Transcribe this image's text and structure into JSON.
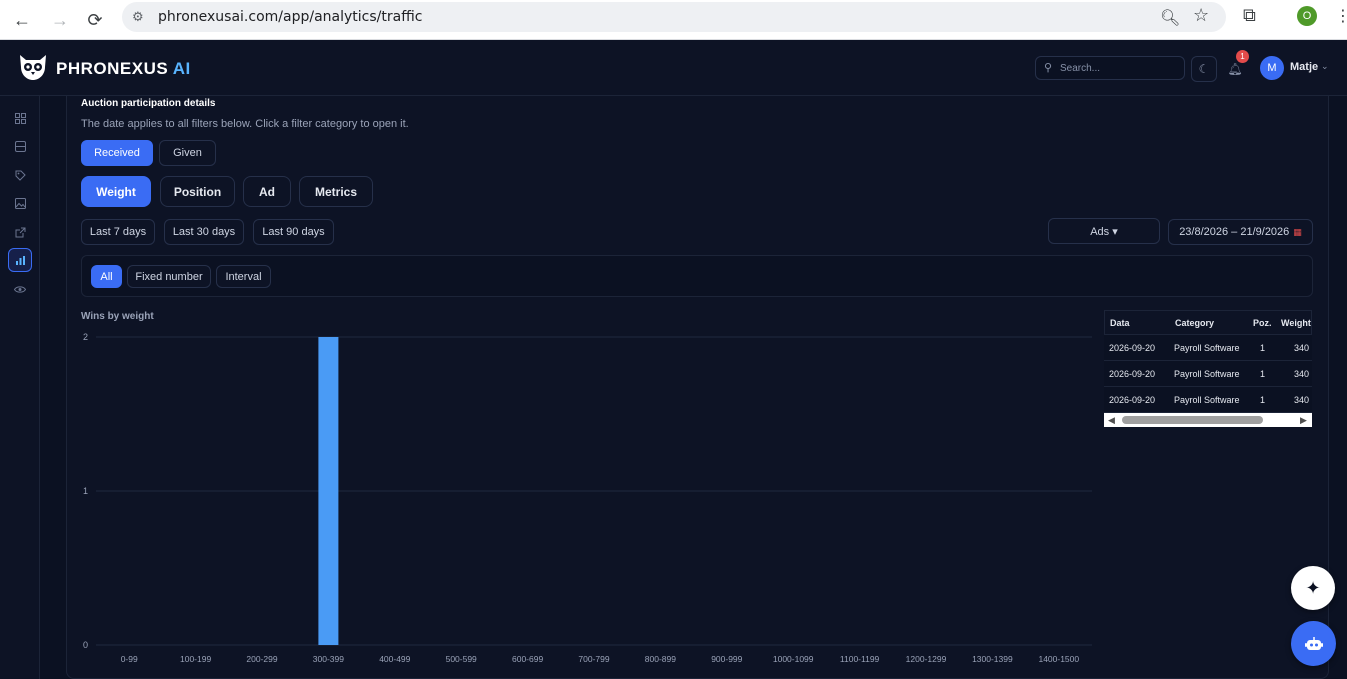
{
  "browser": {
    "url": "phronexusai.com/app/analytics/traffic",
    "profile_initial": "O",
    "icons": [
      "back-icon",
      "forward-icon",
      "reload-icon",
      "site-info-icon",
      "zoom-icon",
      "star-icon",
      "extensions-icon",
      "menu-icon"
    ]
  },
  "header": {
    "brand": "PHRONEXUS",
    "brand_suffix": "AI",
    "search_placeholder": "Search...",
    "notification_count": "1",
    "user_initial": "M",
    "user_name": "Matje"
  },
  "sidebar": {
    "items": [
      {
        "icon": "dashboard-icon"
      },
      {
        "icon": "database-icon"
      },
      {
        "icon": "tag-icon"
      },
      {
        "icon": "image-icon"
      },
      {
        "icon": "external-link-icon"
      },
      {
        "icon": "bar-chart-icon",
        "active": true
      },
      {
        "icon": "eye-icon"
      }
    ]
  },
  "section": {
    "title": "Auction participation details",
    "subtitle": "The date applies to all filters below. Click a filter category to open it."
  },
  "direction": {
    "received": "Received",
    "given": "Given",
    "selected": "Received"
  },
  "tabs": {
    "weight": "Weight",
    "position": "Position",
    "ad": "Ad",
    "metrics": "Metrics",
    "selected": "Weight"
  },
  "ranges": {
    "last7": "Last 7 days",
    "last30": "Last 30 days",
    "last90": "Last 90 days"
  },
  "ads_select": "Ads ▾",
  "date_range": "23/8/2026 – 21/9/2026",
  "weight_filter": {
    "all": "All",
    "fixed": "Fixed number",
    "interval": "Interval",
    "selected": "All"
  },
  "chart_data": {
    "type": "bar",
    "title": "Wins by weight",
    "categories": [
      "0-99",
      "100-199",
      "200-299",
      "300-399",
      "400-499",
      "500-599",
      "600-699",
      "700-799",
      "800-899",
      "900-999",
      "1000-1099",
      "1100-1199",
      "1200-1299",
      "1300-1399",
      "1400-1500"
    ],
    "values": [
      0,
      0,
      0,
      2,
      0,
      0,
      0,
      0,
      0,
      0,
      0,
      0,
      0,
      0,
      0
    ],
    "ylim": [
      0,
      2
    ],
    "yticks": [
      0,
      1,
      2
    ],
    "color": "#4a9bf5",
    "grid": true
  },
  "table": {
    "headers": [
      "Data",
      "Category",
      "Poz.",
      "Weight"
    ],
    "rows": [
      [
        "2026-09-20",
        "Payroll Software",
        "1",
        "340"
      ],
      [
        "2026-09-20",
        "Payroll Software",
        "1",
        "340"
      ],
      [
        "2026-09-20",
        "Payroll Software",
        "1",
        "340"
      ]
    ]
  },
  "colors": {
    "accent": "#3a6cf4",
    "background": "#0b1122",
    "bar": "#4a9bf5"
  }
}
